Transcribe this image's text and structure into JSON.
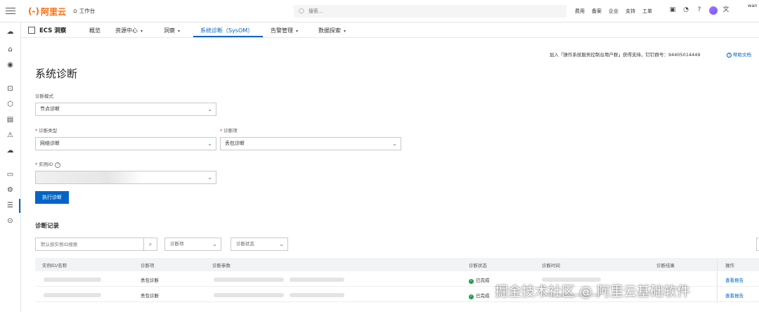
{
  "topbar": {
    "logo_mark": "(-)",
    "logo_text": "阿里云",
    "workbench": "工作台",
    "search_placeholder": "搜索...",
    "links": [
      "费用",
      "备案",
      "企业",
      "支持",
      "工单"
    ],
    "user": "wan"
  },
  "nav": {
    "product": "ECS 洞察",
    "tabs": [
      {
        "label": "概览",
        "dropdown": false
      },
      {
        "label": "资源中心",
        "dropdown": true
      },
      {
        "label": "洞察",
        "dropdown": true
      },
      {
        "label": "系统诊断（SysOM）",
        "dropdown": false,
        "active": true
      },
      {
        "label": "告警管理",
        "dropdown": true
      },
      {
        "label": "数据探索",
        "dropdown": true
      }
    ]
  },
  "page": {
    "support_text": "加入「操作系统服务控制台用户群」获得支持，钉钉群号：94405014449",
    "help_label": "帮助文档",
    "title": "系统诊断",
    "mode_label": "诊断模式",
    "mode_value": "节点诊断",
    "type_label": "诊断类型",
    "type_value": "网络诊断",
    "item_label": "诊断项",
    "item_value": "丢包诊断",
    "instance_label": "实例ID",
    "run_button": "执行诊断"
  },
  "records": {
    "title": "诊断记录",
    "search_placeholder": "默认按实例ID搜索",
    "filter_item": "诊断项",
    "filter_status": "诊断状态",
    "columns": [
      "实例ID/名称",
      "诊断项",
      "诊断参数",
      "诊断状态",
      "诊断时间",
      "诊断结果",
      "操作"
    ],
    "rows": [
      {
        "item": "丢包诊断",
        "status": "已完成",
        "action": "查看报告"
      },
      {
        "item": "丢包诊断",
        "status": "已完成",
        "action": "查看报告"
      }
    ]
  },
  "watermark": "掘金技术社区 @ 阿里云基础软件",
  "colors": {
    "brand": "#ff6a00",
    "accent": "#0064c8",
    "success": "#1e9e4a"
  }
}
